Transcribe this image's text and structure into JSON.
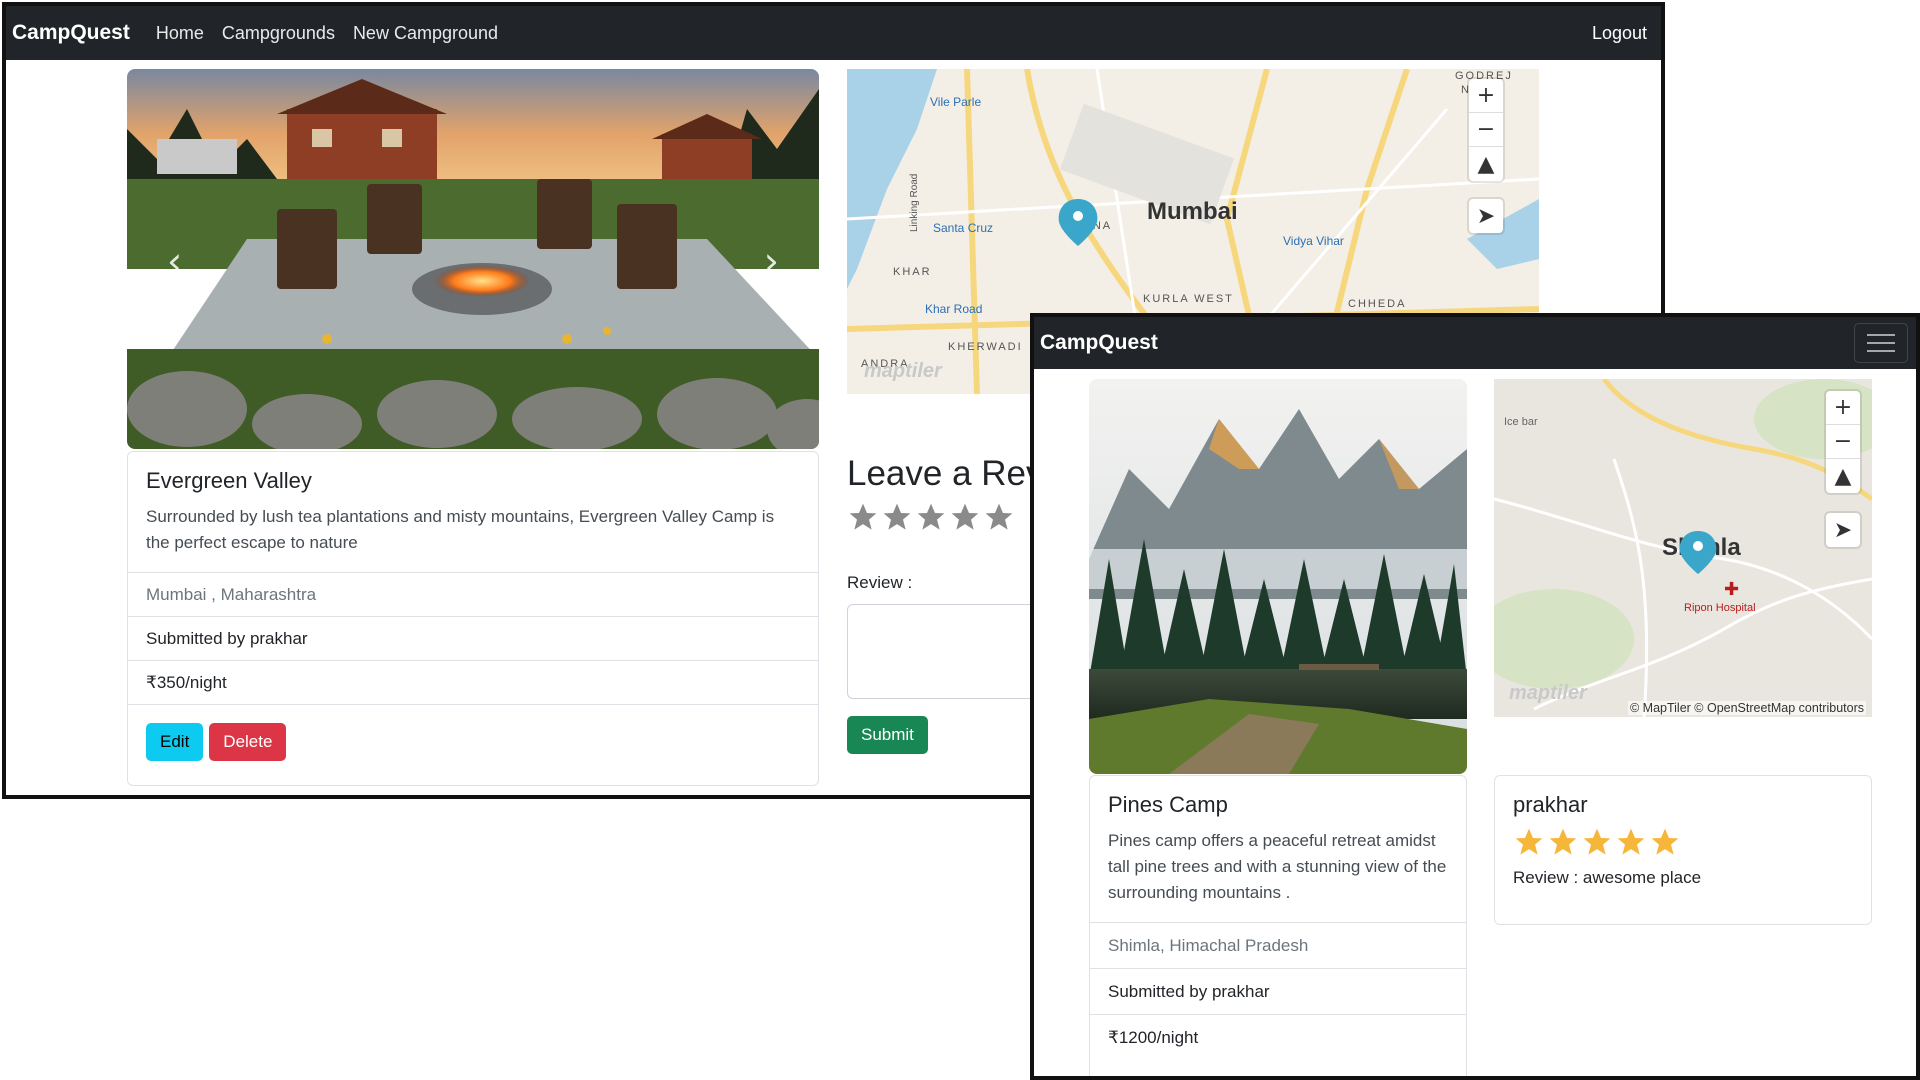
{
  "window1": {
    "navbar": {
      "brand": "CampQuest",
      "links": [
        "Home",
        "Campgrounds",
        "New Campground"
      ],
      "logout": "Logout"
    },
    "campground": {
      "title": "Evergreen Valley",
      "description": "Surrounded by lush tea plantations and misty mountains, Evergreen Valley Camp is the perfect escape to nature",
      "location": "Mumbai , Maharashtra",
      "submitted_by": "Submitted by prakhar",
      "price": "₹350/night",
      "edit_label": "Edit",
      "delete_label": "Delete"
    },
    "map": {
      "city_label": "Mumbai",
      "labels": [
        "Vile Parle",
        "Santa Cruz",
        "KALINA",
        "Vidya Vihar",
        "KHAR",
        "Khar Road",
        "KURLA WEST",
        "CHHEDA",
        "KHERWADI",
        "ANDRA",
        "Linking Road",
        "GODREJ",
        "NAGA"
      ],
      "logo": "maptiler"
    },
    "review_form": {
      "heading": "Leave a Rev",
      "review_label": "Review :",
      "submit_label": "Submit",
      "rating_stars": 5
    }
  },
  "window2": {
    "navbar": {
      "brand": "CampQuest"
    },
    "campground": {
      "title": "Pines Camp",
      "description": "Pines camp offers a peaceful retreat amidst tall pine trees and with a stunning view of the surrounding mountains .",
      "location": "Shimla, Himachal Pradesh",
      "submitted_by": "Submitted by prakhar",
      "price": "₹1200/night"
    },
    "map": {
      "city_label": "Shimla",
      "labels": [
        "Ice bar",
        "Ripon Hospital"
      ],
      "attribution": "© MapTiler © OpenStreetMap contributors",
      "logo": "maptiler"
    },
    "review": {
      "author": "prakhar",
      "rating": 5,
      "text": "Review : awesome place"
    }
  },
  "colors": {
    "navbar": "#212529",
    "edit": "#0dcaf0",
    "delete": "#dc3545",
    "submit": "#198754",
    "star_filled": "#f6b63a",
    "star_empty": "#8a8a8a",
    "marker": "#3aa6c9"
  }
}
